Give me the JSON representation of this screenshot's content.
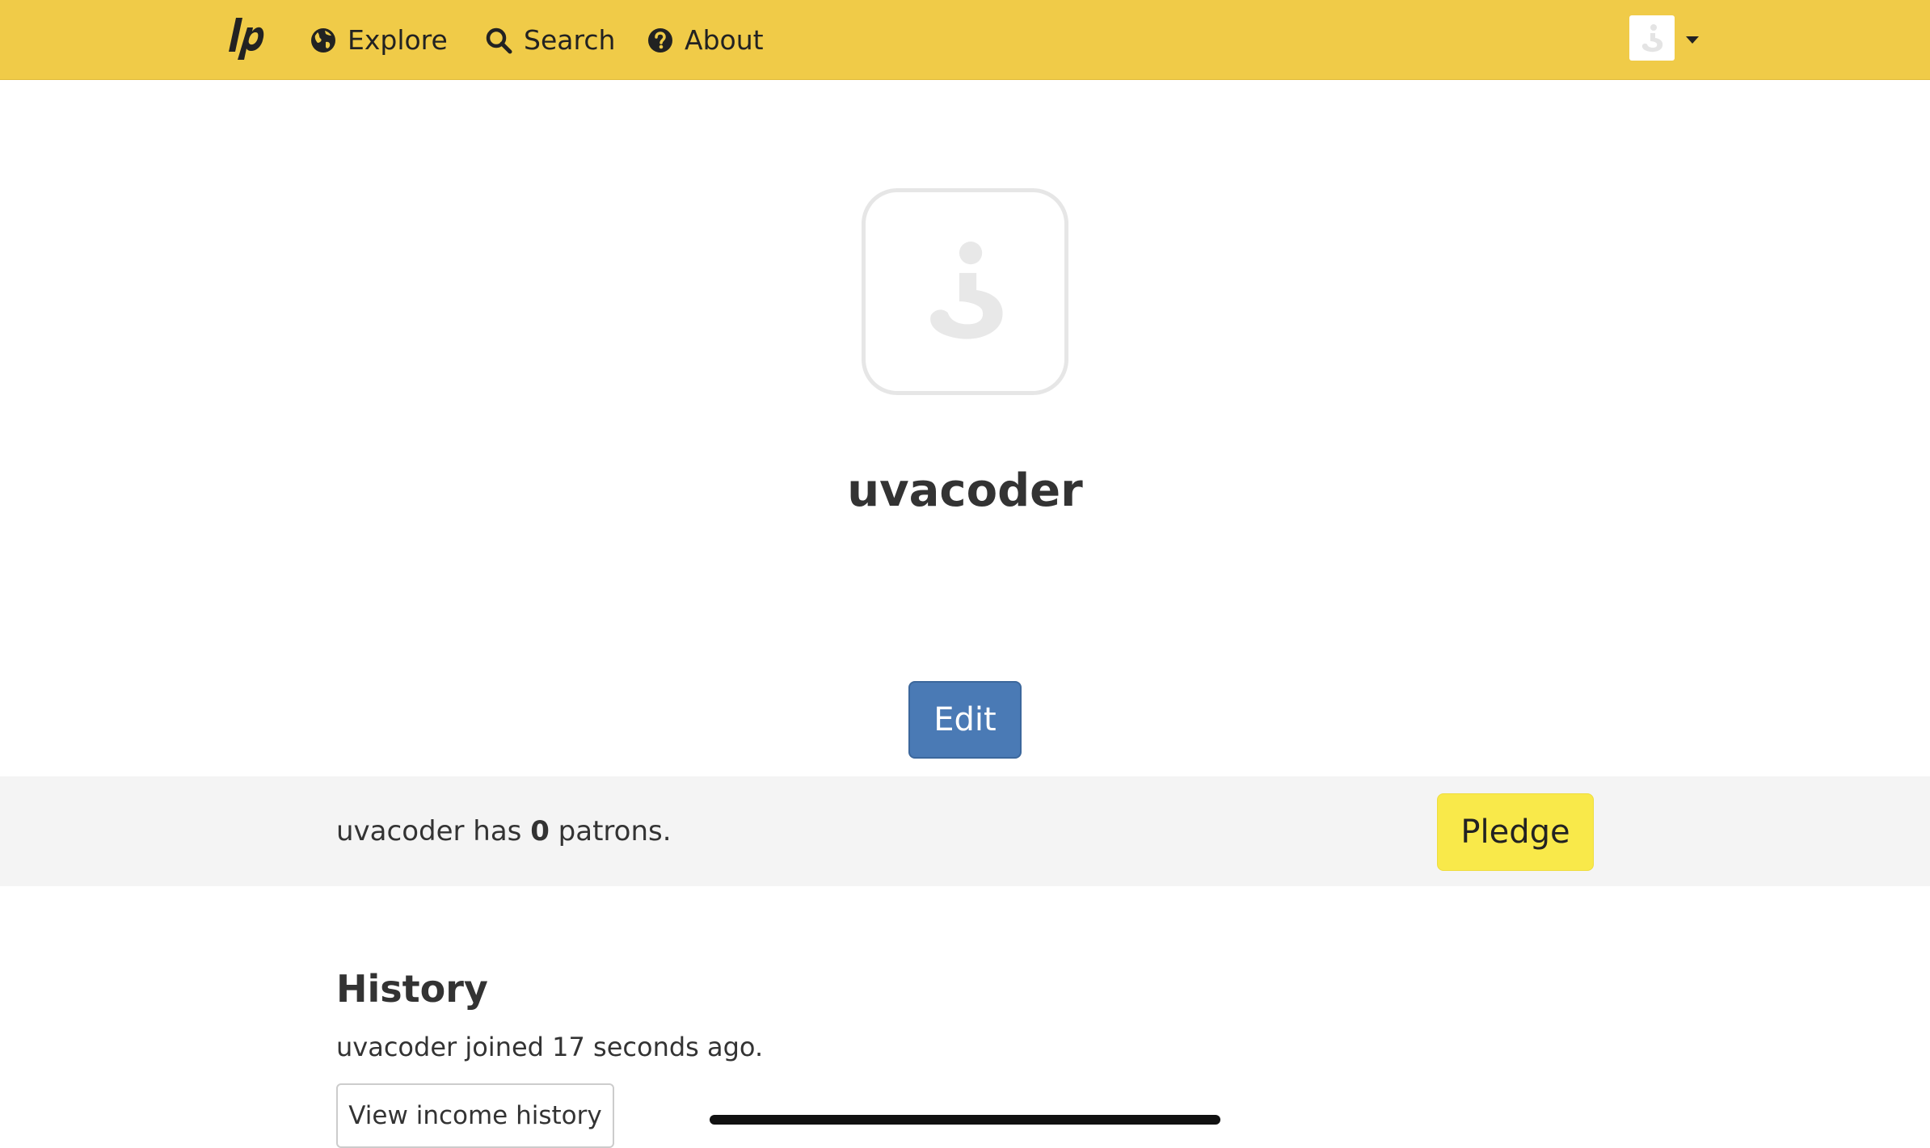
{
  "nav": {
    "brand_icon": "liberapay-logo-icon",
    "explore_label": "Explore",
    "explore_icon": "globe-icon",
    "search_label": "Search",
    "search_icon": "search-icon",
    "about_label": "About",
    "about_icon": "question-circle-icon",
    "user_menu_icon": "default-avatar-icon",
    "user_menu_caret": "caret-down-icon"
  },
  "profile": {
    "avatar_icon": "default-avatar-icon",
    "username": "uvacoder",
    "edit_label": "Edit"
  },
  "patrons": {
    "prefix": "uvacoder has ",
    "count": "0",
    "suffix": " patrons.",
    "pledge_label": "Pledge"
  },
  "history": {
    "heading": "History",
    "joined_text": "uvacoder joined 17 seconds ago.",
    "income_button_label": "View income history"
  },
  "colors": {
    "navbar": "#f0cb48",
    "edit_button": "#4a7ab5",
    "pledge_button": "#f9e94a",
    "band": "#f4f4f4"
  }
}
